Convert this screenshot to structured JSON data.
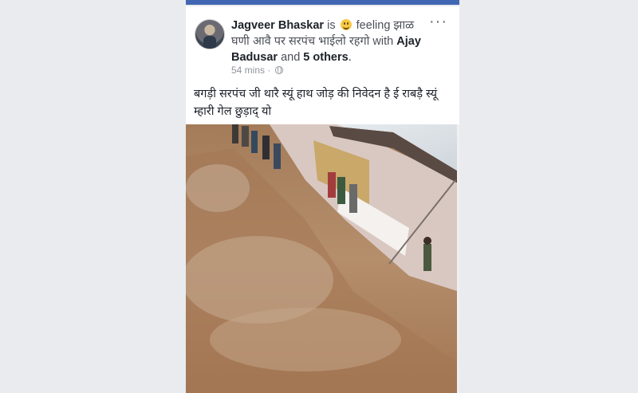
{
  "post": {
    "author": "Jagveer Bhaskar",
    "is_text": "is",
    "feeling_text": "feeling",
    "feeling_value": "झाळ घणी आवै पर सरपंच भाईलो रहगो",
    "with_text": "with",
    "tagged_person": "Ajay Badusar",
    "and_text": "and",
    "others_text": "5 others",
    "period": ".",
    "time": "54 mins",
    "separator": "·",
    "more_icon": "more-dots-icon",
    "privacy_icon": "globe-icon",
    "feeling_icon": "smiley-emoji-icon",
    "body_text": "बगड़ी सरपंच जी थारै स्यूं हाथ जोड़ की निवेदन है ई राबड़ै स्यूं म्हारी गेल छुड़ाद् यो"
  },
  "colors": {
    "brand_bar": "#4267b2",
    "background": "#e9ebee",
    "text": "#1d2129",
    "meta": "#90949c"
  }
}
